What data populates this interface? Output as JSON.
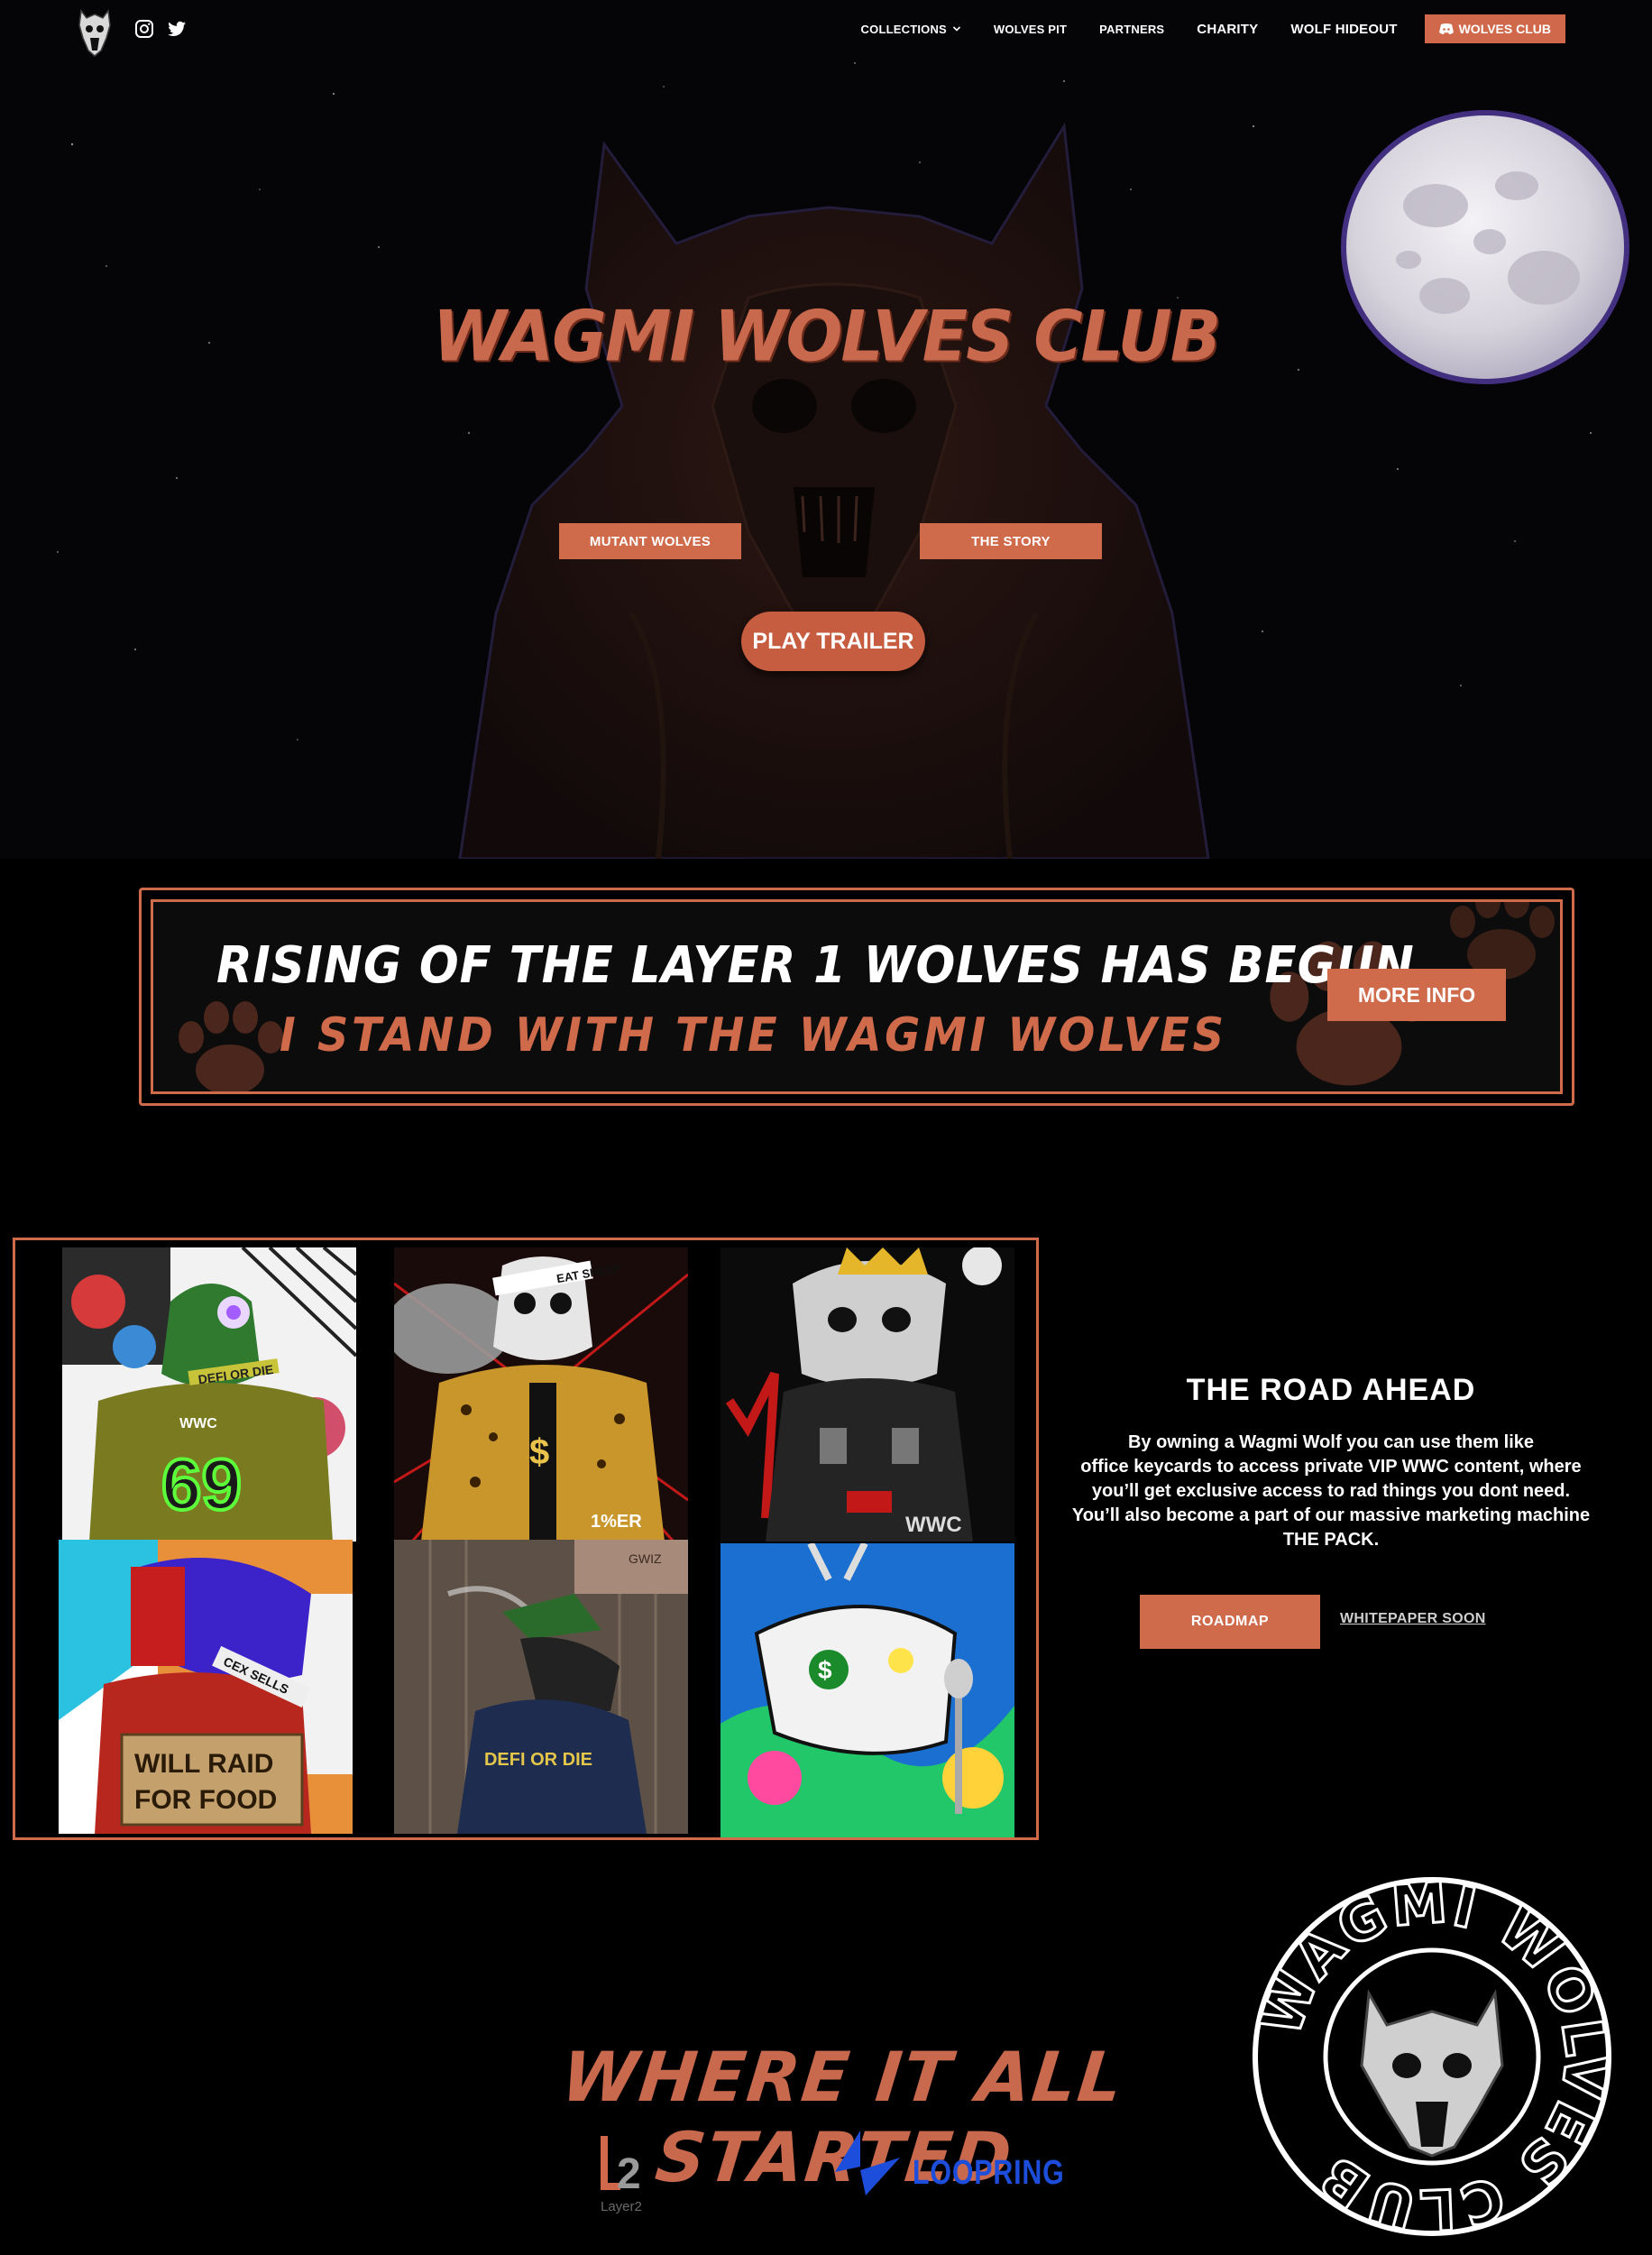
{
  "nav": {
    "links": [
      {
        "label": "COLLECTIONS",
        "has_dropdown": true
      },
      {
        "label": "WOLVES PIT"
      },
      {
        "label": "PARTNERS"
      },
      {
        "label": "CHARITY"
      },
      {
        "label": "WOLF HIDEOUT"
      }
    ],
    "cta_label": "WOLVES CLUB",
    "icons": [
      "wolf-skull-logo",
      "instagram-icon",
      "twitter-icon",
      "chevron-down-icon",
      "discord-icon"
    ]
  },
  "hero": {
    "title": "WAGMI WOLVES CLUB",
    "buttons": [
      "MUTANT WOLVES",
      "THE STORY"
    ],
    "trailer_label": "PLAY TRAILER"
  },
  "banner": {
    "line1": "RISING OF THE LAYER 1 WOLVES HAS BEGUN",
    "line2": "I STAND WITH THE WAGMI WOLVES",
    "button_label": "MORE INFO"
  },
  "gallery": {
    "card_texts": {
      "c1": "DEFI OR DIE",
      "c1_badge": "WWC",
      "c1_number": "69",
      "c2": "EAT SHEEP",
      "c2_tag": "1%ER",
      "c3_tag": "WWC",
      "c4": "CEX SELLS",
      "c4_sign1": "WILL RAID",
      "c4_sign2": "FOR FOOD",
      "c5": "DEFI OR DIE",
      "c5_sign": "GWIZ"
    }
  },
  "road": {
    "title": "THE ROAD AHEAD",
    "lines": [
      "By owning a Wagmi Wolf you can use them like",
      "office keycards to access private VIP WWC content, where",
      "you’ll get exclusive access to rad things you dont need.",
      "You’ll also become a part of our massive marketing machine",
      "THE PACK."
    ],
    "roadmap_label": "ROADMAP",
    "whitepaper_label": "WHITEPAPER SOON"
  },
  "started": {
    "title": "WHERE IT ALL STARTED",
    "l2_mark": "L2",
    "l2_label": "Layer2",
    "loopring_label": "LOOPRING"
  },
  "seal": {
    "text": "WAGMI WOLVES CLUB"
  },
  "colors": {
    "accent": "#cf6a4b",
    "title": "#c8694d",
    "loopring": "#1c4ddb",
    "background": "#000000"
  }
}
